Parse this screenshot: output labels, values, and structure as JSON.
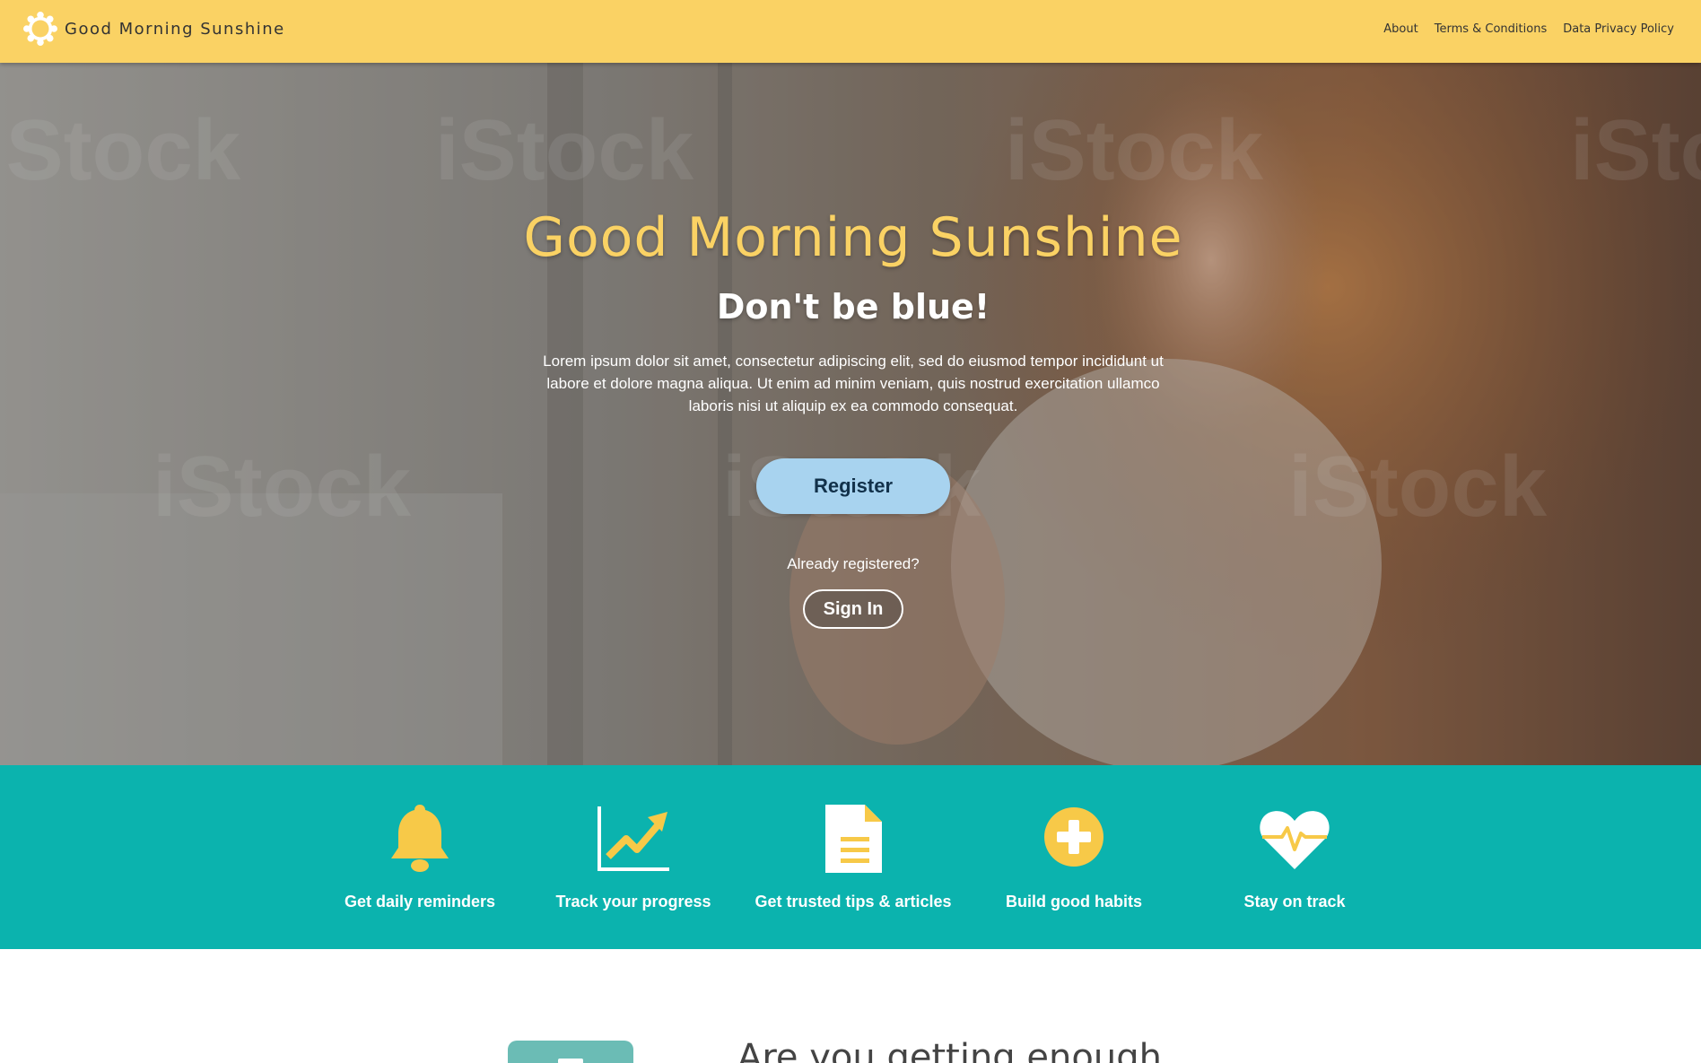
{
  "navbar": {
    "brand_icon": "sun-icon",
    "brand_name": "Good Morning Sunshine",
    "links": [
      "About",
      "Terms & Conditions",
      "Data Privacy Policy"
    ]
  },
  "hero": {
    "title": "Good Morning Sunshine",
    "subtitle": "Don't be blue!",
    "text": "Lorem ipsum dolor sit amet, consectetur adipiscing elit, sed do eiusmod tempor incididunt ut labore et dolore magna aliqua. Ut enim ad minim veniam, quis nostrud exercitation ullamco laboris nisi ut aliquip ex ea commodo consequat.",
    "register_label": "Register",
    "already_registered": "Already registered?",
    "signin_label": "Sign In",
    "watermark_text": "iStock by Getty Images"
  },
  "features": [
    {
      "icon": "bell-icon",
      "label": "Get daily reminders"
    },
    {
      "icon": "trending-chart-icon",
      "label": "Track your progress"
    },
    {
      "icon": "document-icon",
      "label": "Get trusted tips & articles"
    },
    {
      "icon": "plus-circle-icon",
      "label": "Build good habits"
    },
    {
      "icon": "heartbeat-icon",
      "label": "Stay on track"
    }
  ],
  "teaser": {
    "heading": "Are you getting enough"
  },
  "colors": {
    "navbar": "#fad264",
    "accent_yellow": "#fad264",
    "features_bg": "#0bb3ae",
    "register_button": "#a8d3ef",
    "icon_yellow": "#f7c948"
  }
}
